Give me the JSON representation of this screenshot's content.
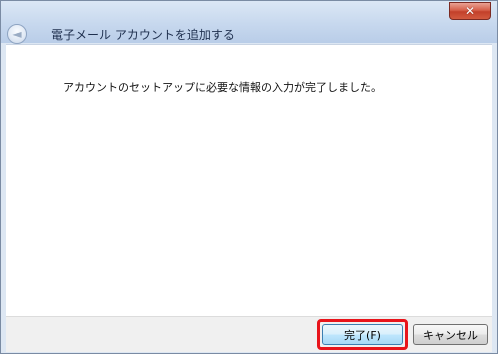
{
  "window": {
    "title": "電子メール アカウントを追加する",
    "close_glyph": "✕",
    "back_glyph": "◄"
  },
  "content": {
    "message": "アカウントのセットアップに必要な情報の入力が完了しました。"
  },
  "buttons": {
    "finish_label": "完了(F)",
    "cancel_label": "キャンセル"
  },
  "colors": {
    "highlight": "#e8141b",
    "close_button": "#c3402a",
    "title_bar": "#c7d8ee"
  },
  "icons": {
    "close": "close-icon",
    "back": "back-arrow-icon"
  }
}
